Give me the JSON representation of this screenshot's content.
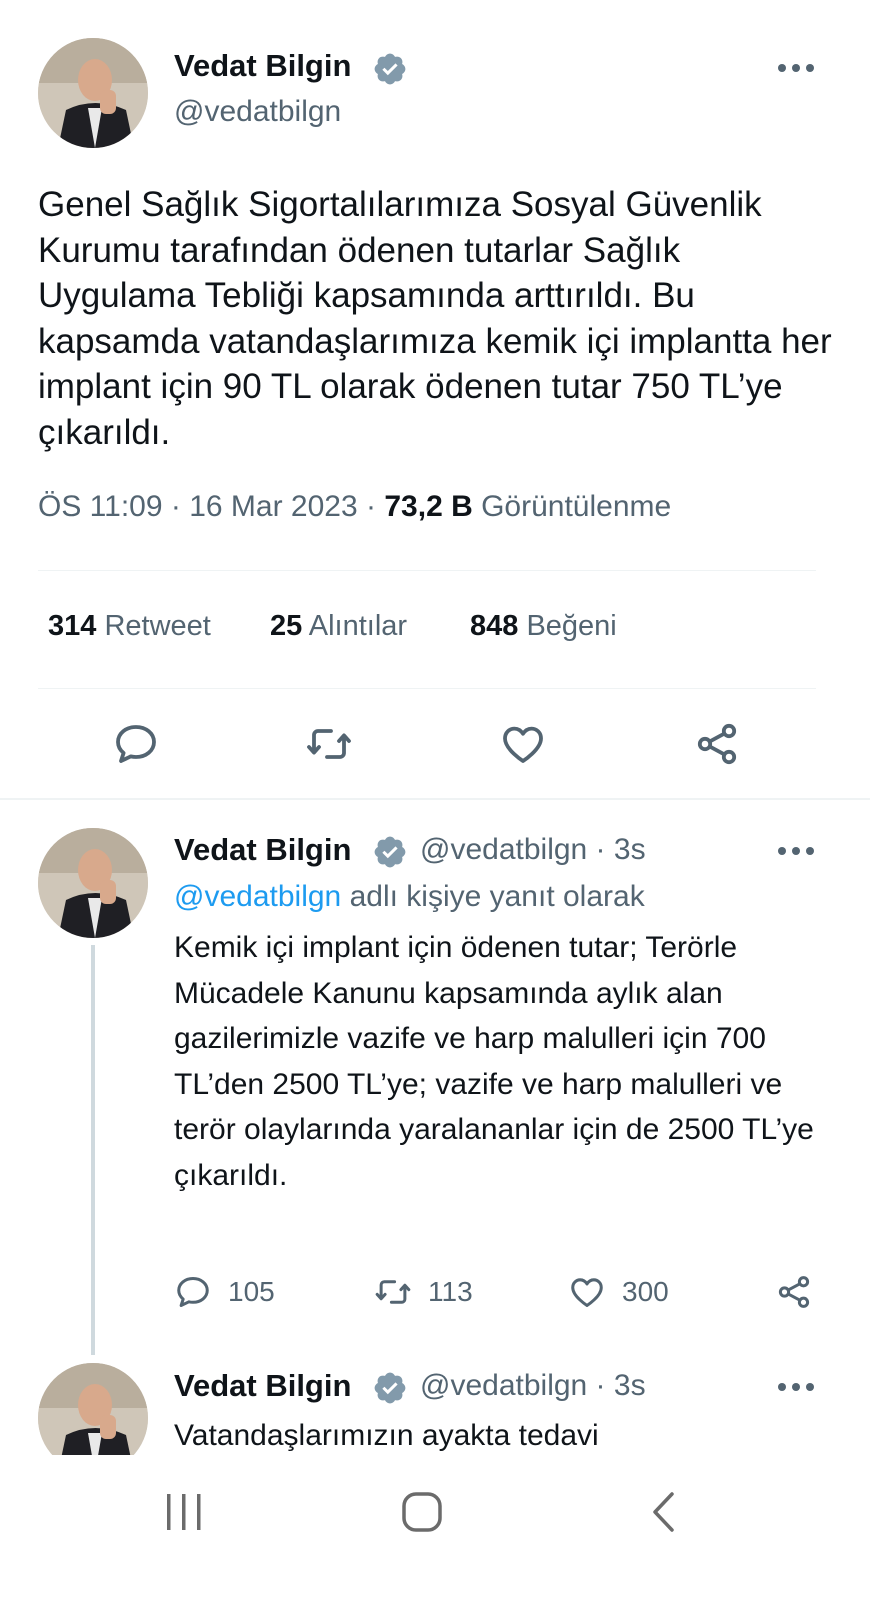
{
  "main_tweet": {
    "author_name": "Vedat Bilgin",
    "handle": "@vedatbilgn",
    "verified_icon": "verified-badge-icon",
    "text": "Genel Sağlık Sigortalılarımıza Sosyal Güvenlik Kurumu tarafından ödenen tutarlar Sağlık Uygulama Tebliği kapsamında arttırıldı. Bu kapsamda vatandaşlarımıza kemik içi implantta her implant için 90 TL olarak ödenen tutar 750 TL’ye çıkarıldı.",
    "time": "ÖS 11:09",
    "sep1": "·",
    "date": "16 Mar 2023",
    "sep2": "·",
    "views_count": "73,2 B",
    "views_label": "Görüntülenme",
    "stats": {
      "retweets_count": "314",
      "retweets_label": "Retweet",
      "quotes_count": "25",
      "quotes_label": "Alıntılar",
      "likes_count": "848",
      "likes_label": "Beğeni"
    },
    "actions": [
      "reply-icon",
      "retweet-icon",
      "like-icon",
      "share-icon"
    ]
  },
  "reply_1": {
    "author_name": "Vedat Bilgin",
    "handle_time": "@vedatbilgn · 3s",
    "reply_to_mention": "@vedatbilgn",
    "reply_to_suffix": " adlı kişiye yanıt olarak",
    "text": "Kemik içi implant için ödenen tutar; Terörle Mücadele Kanunu kapsamında aylık alan gazilerimizle vazife ve harp malulleri için 700 TL’den 2500 TL’ye; vazife ve harp malulleri ve terör olaylarında yaralananlar için de 2500 TL’ye çıkarıldı.",
    "replies": "105",
    "retweets": "113",
    "likes": "300"
  },
  "reply_2": {
    "author_name": "Vedat Bilgin",
    "handle_time": "@vedatbilgn · 3s",
    "text": "Vatandaşlarımızın ayakta tedavi"
  },
  "navbar": {
    "buttons": [
      "recent-apps-icon",
      "home-icon",
      "back-icon"
    ]
  },
  "colors": {
    "text_primary": "#0f1419",
    "text_secondary": "#536471",
    "accent": "#1d9bf0",
    "divider": "#eff3f4",
    "thread_line": "#cfd9de"
  }
}
